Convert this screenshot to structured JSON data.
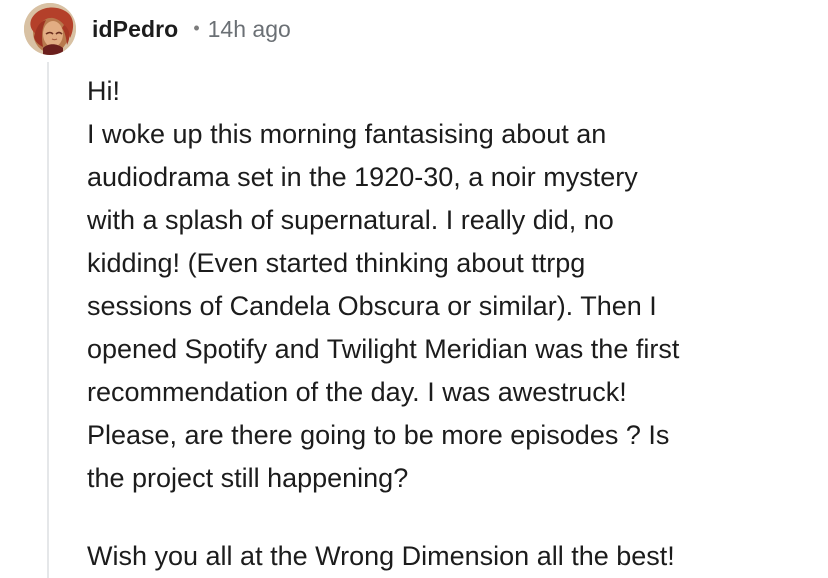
{
  "comment": {
    "author": "idPedro",
    "separator": "•",
    "timestamp": "14h ago",
    "avatar_icon": "user-avatar-icon",
    "paragraphs": [
      [
        "Hi!",
        "I woke up this morning fantasising about an",
        "audiodrama set in the 1920-30, a noir mystery",
        "with a splash of supernatural. I really did, no",
        "kidding! (Even started thinking about ttrpg",
        "sessions of Candela Obscura or similar). Then I",
        "opened Spotify and Twilight Meridian was the first",
        "recommendation of the day. I was awestruck!",
        "Please, are there going to be more episodes ? Is",
        "the project still happening?"
      ],
      [
        "Wish you all at the Wrong Dimension all the best!"
      ]
    ]
  },
  "colors": {
    "text": "#1c1c1c",
    "muted": "#6b7075",
    "thread_line": "#e5e7e9"
  }
}
